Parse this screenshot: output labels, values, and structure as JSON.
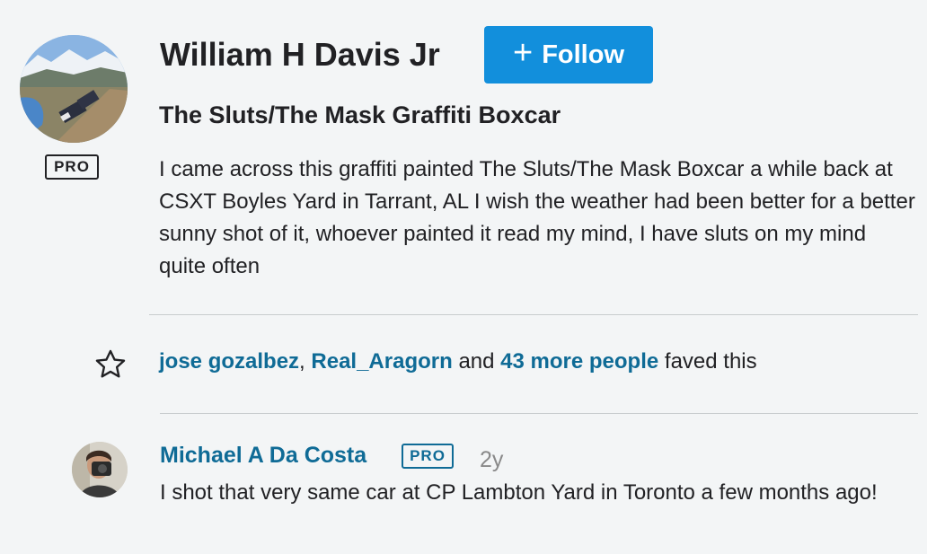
{
  "photo_owner": {
    "name": "William H Davis Jr",
    "badge": "PRO",
    "follow_label": "Follow"
  },
  "photo": {
    "title": "The Sluts/The Mask Graffiti Boxcar",
    "description": "I came across this graffiti painted The Sluts/The Mask Boxcar a while back at CSXT Boyles Yard in Tarrant, AL I wish the weather had been better for a better sunny shot of it, whoever painted it read my mind, I have sluts on my mind quite often"
  },
  "faves": {
    "user1": "jose gozalbez",
    "separator": ",",
    "user2": "Real_Aragorn",
    "and_text": "and",
    "more_link": "43 more people",
    "suffix": "faved this"
  },
  "comments": [
    {
      "author": "Michael A Da Costa",
      "badge": "PRO",
      "age": "2y",
      "text": "I shot that very same car at CP Lambton Yard in Toronto a few months ago!"
    }
  ],
  "icons": {
    "star": "star-outline-icon",
    "plus": "plus-icon"
  },
  "colors": {
    "follow_button": "#128fdc",
    "link": "#0f6b96",
    "background": "#f3f5f6"
  }
}
